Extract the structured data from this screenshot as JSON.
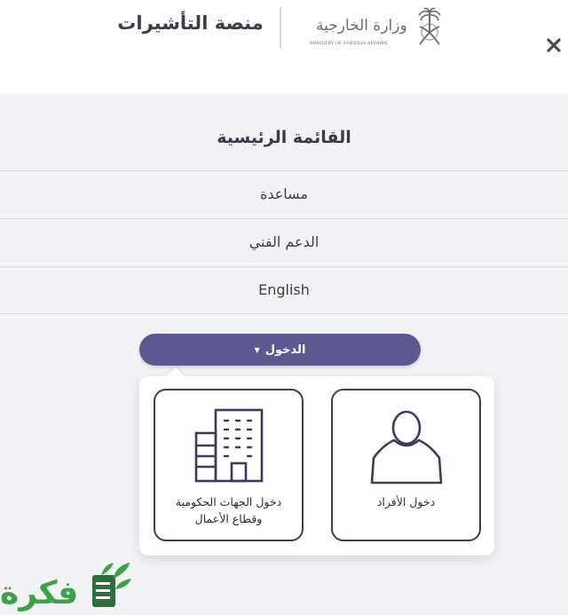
{
  "header": {
    "platform_name": "منصة التأشيرات",
    "ministry_logo_ar": "وزارة الخارجية",
    "ministry_logo_en": "MINISTRY OF FOREIGN AFFAIRS",
    "close_icon": "close-icon",
    "emblem_icon": "palm-swords-emblem-icon"
  },
  "menu": {
    "title": "القائمة الرئيسية",
    "items": [
      {
        "label": "مساعدة"
      },
      {
        "label": "الدعم الفني"
      },
      {
        "label": "English"
      }
    ]
  },
  "login": {
    "button_label": "الدخول",
    "caret_icon": "caret-down-icon",
    "options": [
      {
        "label": "دخول الأفراد",
        "icon": "person-icon"
      },
      {
        "label": "دخول الجهات الحكومية وقطاع الأعمال",
        "icon": "building-icon"
      }
    ]
  },
  "watermark": {
    "text": "فكرة",
    "icon": "book-leaf-icon"
  },
  "colors": {
    "accent": "#5d5891",
    "card_border": "#3d3a60",
    "menu_bg": "#f3f3f6",
    "watermark_green": "#3aa34a"
  }
}
